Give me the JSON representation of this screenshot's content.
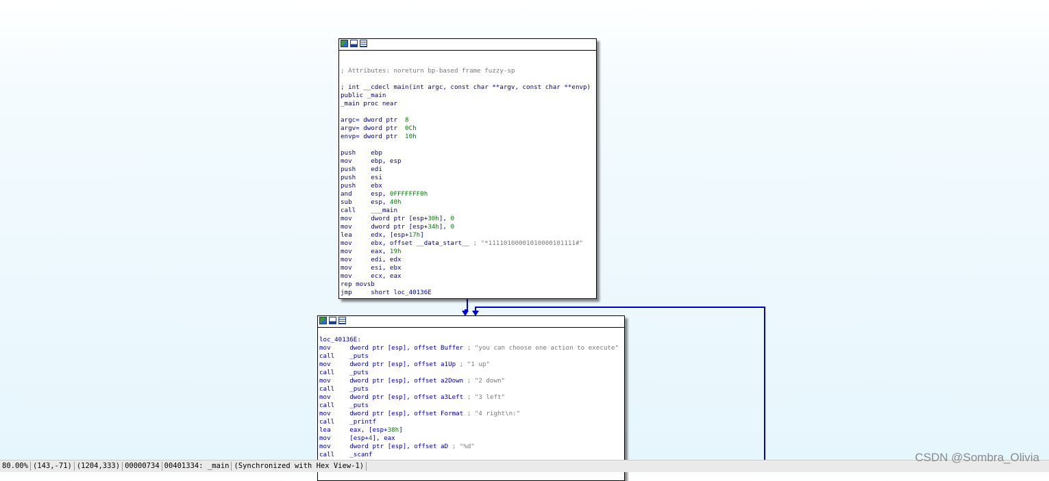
{
  "block1": {
    "lines": [
      [],
      [],
      [
        {
          "t": "; Attributes: noreturn bp-based frame fuzzy-sp",
          "c": "cmt"
        }
      ],
      [],
      [
        {
          "t": "; int __cdecl main(int argc, const char **argv, const char **envp)"
        }
      ],
      [
        {
          "t": "public _main"
        }
      ],
      [
        {
          "t": "_main proc near"
        }
      ],
      [],
      [
        {
          "t": "argc= dword ptr  "
        },
        {
          "t": "8",
          "c": "num"
        }
      ],
      [
        {
          "t": "argv= dword ptr  "
        },
        {
          "t": "0Ch",
          "c": "num"
        }
      ],
      [
        {
          "t": "envp= dword ptr  "
        },
        {
          "t": "10h",
          "c": "num"
        }
      ],
      [],
      [
        {
          "t": "push    ebp"
        }
      ],
      [
        {
          "t": "mov     ebp, esp"
        }
      ],
      [
        {
          "t": "push    edi"
        }
      ],
      [
        {
          "t": "push    esi"
        }
      ],
      [
        {
          "t": "push    ebx"
        }
      ],
      [
        {
          "t": "and     esp, "
        },
        {
          "t": "0FFFFFFF0h",
          "c": "num"
        }
      ],
      [
        {
          "t": "sub     esp, "
        },
        {
          "t": "40h",
          "c": "num"
        }
      ],
      [
        {
          "t": "call    ___main"
        }
      ],
      [
        {
          "t": "mov     dword ptr [esp+"
        },
        {
          "t": "30h",
          "c": "num"
        },
        {
          "t": "], "
        },
        {
          "t": "0",
          "c": "num"
        }
      ],
      [
        {
          "t": "mov     dword ptr [esp+"
        },
        {
          "t": "34h",
          "c": "num"
        },
        {
          "t": "], "
        },
        {
          "t": "0",
          "c": "num"
        }
      ],
      [
        {
          "t": "lea     edx, [esp+"
        },
        {
          "t": "17h",
          "c": "num"
        },
        {
          "t": "]"
        }
      ],
      [
        {
          "t": "mov     ebx, offset __data_start__ "
        },
        {
          "t": "; \"*11110100001010000101111#\"",
          "c": "str"
        }
      ],
      [
        {
          "t": "mov     eax, "
        },
        {
          "t": "19h",
          "c": "num"
        }
      ],
      [
        {
          "t": "mov     edi, edx"
        }
      ],
      [
        {
          "t": "mov     esi, ebx"
        }
      ],
      [
        {
          "t": "mov     ecx, eax"
        }
      ],
      [
        {
          "t": "rep movsb"
        }
      ],
      [
        {
          "t": "jmp     short loc_40136E"
        }
      ]
    ]
  },
  "block2": {
    "lines": [
      [],
      [
        {
          "t": "loc_40136E:"
        }
      ],
      [
        {
          "t": "mov     dword ptr [esp], offset Buffer "
        },
        {
          "t": "; \"you can choose one action to execute\"",
          "c": "str"
        }
      ],
      [
        {
          "t": "call    _puts"
        }
      ],
      [
        {
          "t": "mov     dword ptr [esp], offset a1Up "
        },
        {
          "t": "; \"1 up\"",
          "c": "str"
        }
      ],
      [
        {
          "t": "call    _puts"
        }
      ],
      [
        {
          "t": "mov     dword ptr [esp], offset a2Down "
        },
        {
          "t": "; \"2 down\"",
          "c": "str"
        }
      ],
      [
        {
          "t": "call    _puts"
        }
      ],
      [
        {
          "t": "mov     dword ptr [esp], offset a3Left "
        },
        {
          "t": "; \"3 left\"",
          "c": "str"
        }
      ],
      [
        {
          "t": "call    _puts"
        }
      ],
      [
        {
          "t": "mov     dword ptr [esp], offset Format "
        },
        {
          "t": "; \"4 right\\n:\"",
          "c": "str"
        }
      ],
      [
        {
          "t": "call    _printf"
        }
      ],
      [
        {
          "t": "lea     eax, [esp+"
        },
        {
          "t": "38h",
          "c": "num"
        },
        {
          "t": "]"
        }
      ],
      [
        {
          "t": "mov     [esp+"
        },
        {
          "t": "4",
          "c": "num"
        },
        {
          "t": "], eax"
        }
      ],
      [
        {
          "t": "mov     dword ptr [esp], offset aD "
        },
        {
          "t": "; \"%d\"",
          "c": "str"
        }
      ],
      [
        {
          "t": "call    _scanf"
        }
      ]
    ]
  },
  "status": {
    "zoom": "80.00%",
    "pos1": "(143,-71)",
    "pos2": "(1204,333)",
    "offset": "00000734",
    "address": "00401334: _main",
    "sync": "(Synchronized with Hex View-1)"
  },
  "watermark": "CSDN @Sombra_Olivia",
  "colors": {
    "edge": "#0000cc",
    "comment": "#7a7a7a",
    "number": "#008000",
    "code": "#0000aa"
  },
  "icons": [
    "graph-icon",
    "chart-icon",
    "list-icon"
  ]
}
